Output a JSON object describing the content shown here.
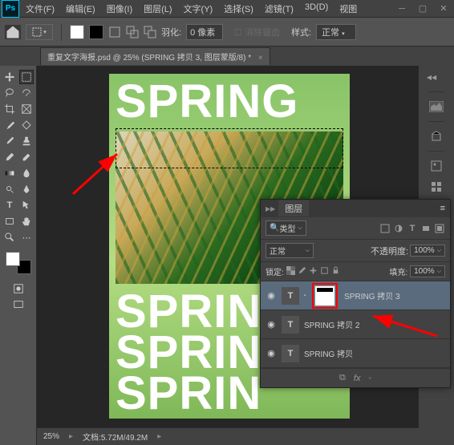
{
  "menu": {
    "file": "文件(F)",
    "edit": "编辑(E)",
    "image": "图像(I)",
    "layer": "图层(L)",
    "type": "文字(Y)",
    "select": "选择(S)",
    "filter": "滤镜(T)",
    "three_d": "3D(D)",
    "view": "视图"
  },
  "optbar": {
    "feather_label": "羽化:",
    "feather_value": "0 像素",
    "antialias": "消除锯齿",
    "style_label": "样式:",
    "style_value": "正常"
  },
  "tab": {
    "title": "重复文字海报.psd @ 25% (SPRING 拷贝 3, 图层蒙版/8) *"
  },
  "canvas_text": {
    "spring": "SPRING",
    "spring_clip": "SPRIN"
  },
  "statusbar": {
    "zoom": "25%",
    "doc": "文档:5.72M/49.2M"
  },
  "layers": {
    "title": "图层",
    "filter": "类型",
    "blend": "正常",
    "opacity_label": "不透明度:",
    "opacity_value": "100%",
    "lock_label": "锁定:",
    "fill_label": "填充:",
    "fill_value": "100%",
    "items": [
      {
        "name": "SPRING 拷贝 3",
        "selected": true,
        "hasmask": true
      },
      {
        "name": "SPRING 拷贝 2",
        "selected": false,
        "hasmask": false
      },
      {
        "name": "SPRING 拷贝",
        "selected": false,
        "hasmask": false
      }
    ]
  }
}
